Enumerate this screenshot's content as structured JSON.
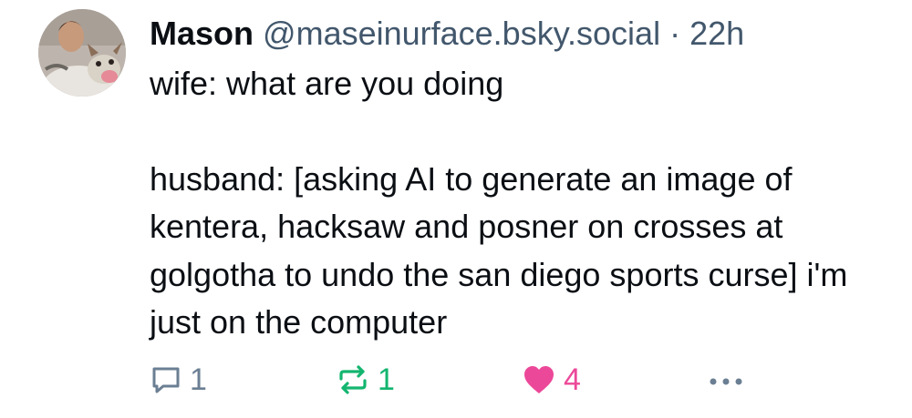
{
  "post": {
    "author": {
      "display_name": "Mason",
      "handle": "@maseinurface.bsky.social",
      "avatar_icon": "user-avatar-photo"
    },
    "separator": "·",
    "time": "22h",
    "text": {
      "line1": "wife: what are you doing",
      "paragraph2": "husband: [asking AI to generate an image of kentera, hacksaw and posner on crosses at golgotha to undo the san diego sports curse] i'm just on the computer"
    },
    "actions": {
      "reply": {
        "icon": "reply-bubble-icon",
        "count": "1",
        "color": "#6b7f93"
      },
      "repost": {
        "icon": "repost-arrows-icon",
        "count": "1",
        "color": "#13b56f"
      },
      "like": {
        "icon": "heart-icon",
        "count": "4",
        "color": "#ec4899"
      },
      "more": {
        "icon": "more-dots-icon"
      }
    }
  }
}
